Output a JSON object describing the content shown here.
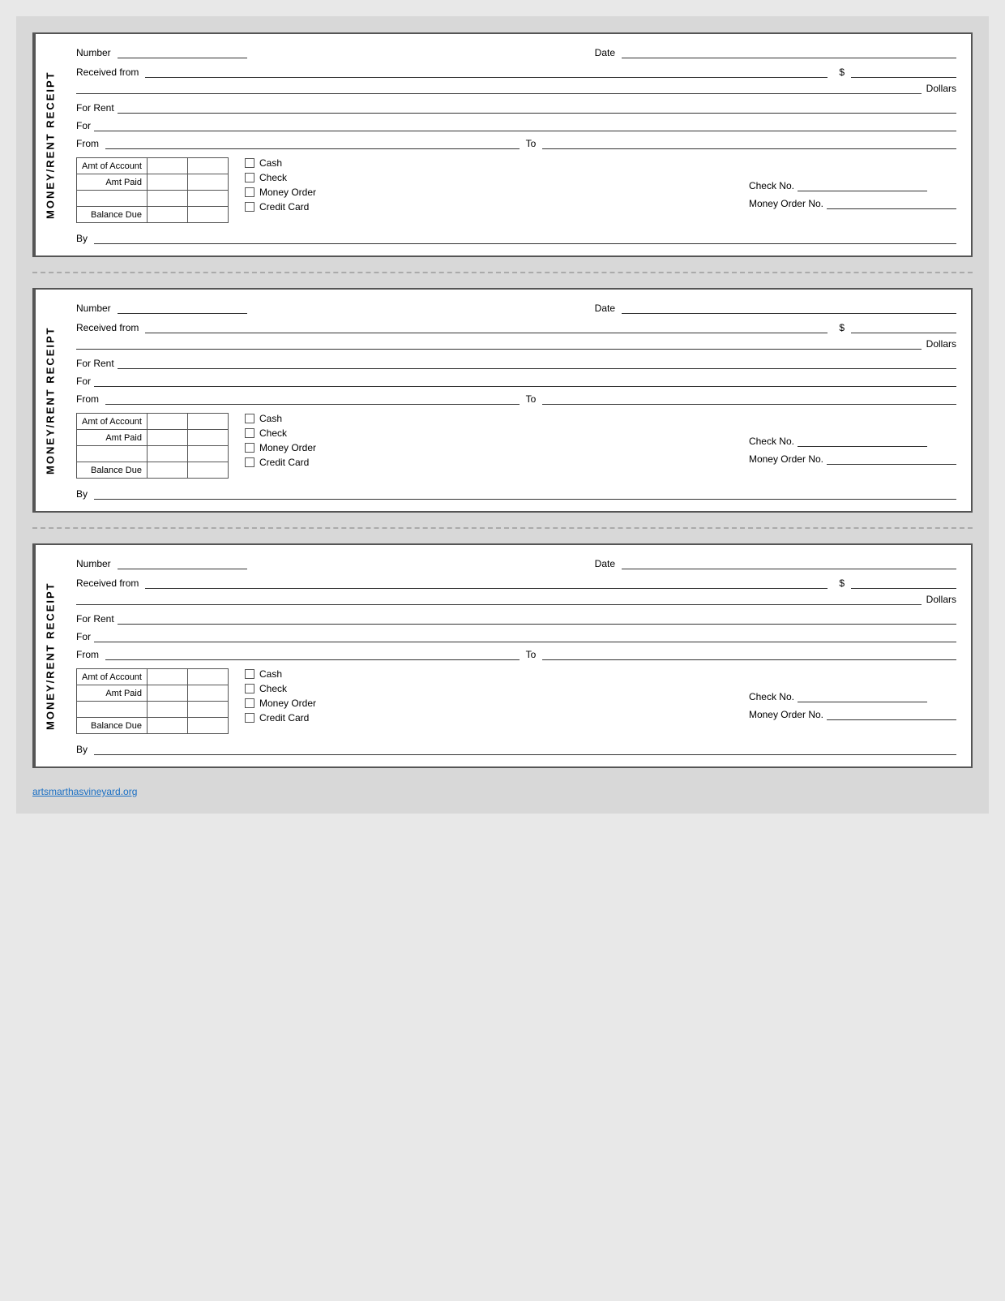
{
  "receipts": [
    {
      "id": 1,
      "sidebar_text": "MONEY/RENT RECEIPT",
      "number_label": "Number",
      "date_label": "Date",
      "received_from_label": "Received from",
      "dollars_label": "Dollars",
      "for_rent_label": "For  Rent",
      "for_label": "For",
      "from_label": "From",
      "to_label": "To",
      "amt_of_account_label": "Amt of Account",
      "amt_paid_label": "Amt Paid",
      "balance_due_label": "Balance Due",
      "cash_label": "Cash",
      "check_label": "Check",
      "money_order_label": "Money Order",
      "credit_card_label": "Credit Card",
      "check_no_label": "Check No.",
      "money_order_no_label": "Money Order No.",
      "by_label": "By"
    },
    {
      "id": 2,
      "sidebar_text": "MONEY/RENT RECEIPT",
      "number_label": "Number",
      "date_label": "Date",
      "received_from_label": "Received from",
      "dollars_label": "Dollars",
      "for_rent_label": "For  Rent",
      "for_label": "For",
      "from_label": "From",
      "to_label": "To",
      "amt_of_account_label": "Amt of Account",
      "amt_paid_label": "Amt Paid",
      "balance_due_label": "Balance Due",
      "cash_label": "Cash",
      "check_label": "Check",
      "money_order_label": "Money Order",
      "credit_card_label": "Credit Card",
      "check_no_label": "Check No.",
      "money_order_no_label": "Money Order No.",
      "by_label": "By"
    },
    {
      "id": 3,
      "sidebar_text": "MONEY/RENT RECEIPT",
      "number_label": "Number",
      "date_label": "Date",
      "received_from_label": "Received from",
      "dollars_label": "Dollars",
      "for_rent_label": "For  Rent",
      "for_label": "For",
      "from_label": "From",
      "to_label": "To",
      "amt_of_account_label": "Amt of Account",
      "amt_paid_label": "Amt Paid",
      "balance_due_label": "Balance Due",
      "cash_label": "Cash",
      "check_label": "Check",
      "money_order_label": "Money Order",
      "credit_card_label": "Credit Card",
      "check_no_label": "Check No.",
      "money_order_no_label": "Money Order No.",
      "by_label": "By"
    }
  ],
  "watermark": "artsmarthasvineyard.org"
}
